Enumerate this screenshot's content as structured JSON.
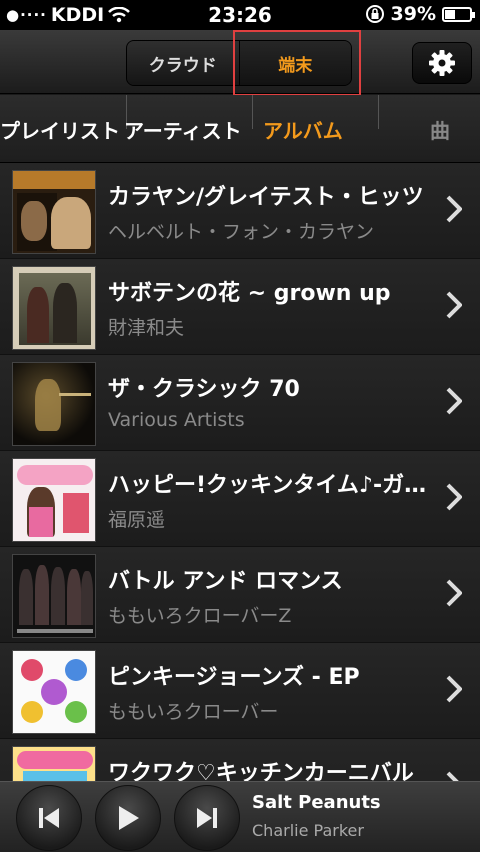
{
  "status": {
    "carrier": "KDDI",
    "time": "23:26",
    "battery": "39%"
  },
  "header": {
    "cloud_label": "クラウド",
    "device_label": "端末",
    "settings_icon": "gear-icon"
  },
  "tabs": {
    "playlist": "プレイリスト",
    "artist": "アーティスト",
    "album": "アルバム",
    "song": "曲"
  },
  "albums": [
    {
      "title": "カラヤン/グレイテスト・ヒッツ",
      "artist": "ヘルベルト・フォン・カラヤン"
    },
    {
      "title": "サボテンの花 ~ grown up",
      "artist": "財津和夫"
    },
    {
      "title": "ザ・クラシック 70",
      "artist": "Various Artists"
    },
    {
      "title": "ハッピー!クッキンタイム♪-ガクショク",
      "artist": "福原遥"
    },
    {
      "title": "バトル アンド ロマンス",
      "artist": "ももいろクローバーZ"
    },
    {
      "title": "ピンキージョーンズ - EP",
      "artist": "ももいろクローバー"
    },
    {
      "title": "ワクワク♡キッチンカーニバル",
      "artist": ""
    }
  ],
  "now_playing": {
    "title": "Salt Peanuts",
    "artist": "Charlie Parker"
  },
  "colors": {
    "accent": "#f39a1c",
    "highlight": "#e04040"
  }
}
